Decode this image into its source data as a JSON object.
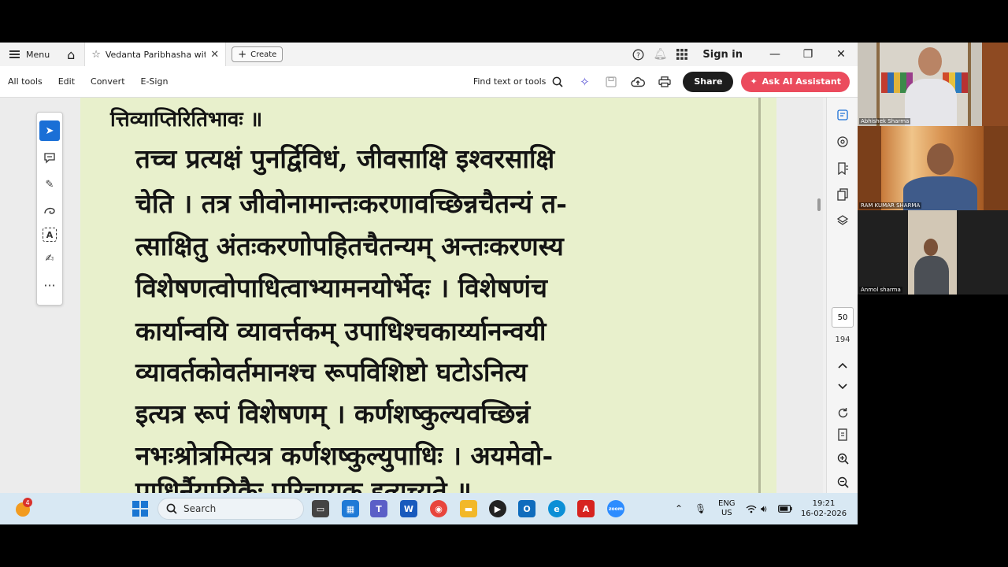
{
  "titlebar": {
    "menu_label": "Menu",
    "tab_title": "Vedanta Paribhasha wit...",
    "create_label": "Create",
    "signin_label": "Sign in"
  },
  "toolbar": {
    "tabs": [
      "All tools",
      "Edit",
      "Convert",
      "E-Sign"
    ],
    "find_label": "Find text or tools",
    "share_label": "Share",
    "ai_label": "Ask AI Assistant"
  },
  "document": {
    "lines": [
      "त्तिव्याप्तिरितिभावः ॥",
      "तच्च प्रत्यक्षं पुनर्द्विविधं,   जीवसाक्षि   इश्वरसाक्षि",
      "चेति । तत्र जीवोनामान्तःकरणावच्छिन्नचैतन्यं त-",
      "त्साक्षितु अंतःकरणोपहितचैतन्यम् अन्तःकरणस्य",
      "विशेषणत्वोपाधित्वाभ्यामनयोर्भेदः ।  विशेषणंच",
      "कार्यान्वयि   व्यावर्त्तकम् उपाधिश्चकार्य्यानन्वयी",
      "व्यावर्तकोवर्तमानश्च   रूपविशिष्टो   घटोऽनित्य",
      "इत्यत्र  रूपं  विशेषणम्  ।  कर्णशष्कुल्यवच्छिन्नं",
      "नभःश्रोत्रमित्यत्र  कर्णशष्कुल्युपाधिः  ।  अयमेवो-",
      "पाधिर्नैयायिकैः परिचायक इत्युच्यते ॥"
    ]
  },
  "navigation": {
    "current_page": "50",
    "total_pages": "194"
  },
  "taskbar": {
    "weather_badge": "4",
    "search_label": "Search",
    "lang_line1": "ENG",
    "lang_line2": "US",
    "time": "19:21",
    "date": "16-02-2026"
  },
  "video": {
    "participants": [
      "Abhishek Sharma",
      "RAM KUMAR SHARMA",
      "Anmol sharma"
    ]
  },
  "colors": {
    "accent_blue": "#1a6fd6",
    "ai_button": "#eb4b5d",
    "page_bg": "#e8f0cc",
    "taskbar_bg": "#d8e8f3"
  }
}
